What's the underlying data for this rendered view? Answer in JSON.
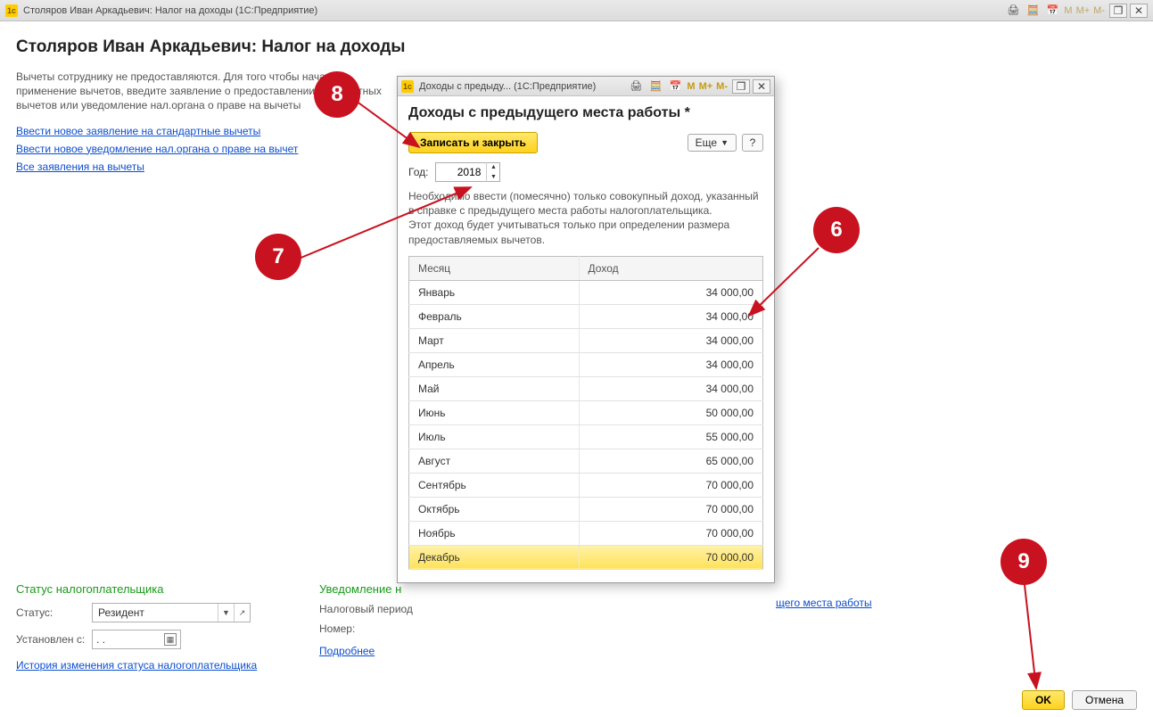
{
  "main_window": {
    "title": "Столяров Иван Аркадьевич: Налог на доходы  (1С:Предприятие)",
    "page_heading": "Столяров Иван Аркадьевич: Налог на доходы",
    "description": "Вычеты сотруднику не предоставляются. Для того чтобы начать применение вычетов, введите заявление о предоставлении стандартных вычетов или уведомление нал.органа о праве на вычеты",
    "links": {
      "std_deduction": "Ввести новое заявление на стандартные вычеты",
      "notice": "Ввести новое уведомление нал.органа о праве на вычет",
      "all_statements": "Все заявления на вычеты"
    },
    "status_section_title": "Статус налогоплательщика",
    "status_label": "Статус:",
    "status_value": "Резидент",
    "set_from_label": "Установлен с:",
    "set_from_value": "  .  .    ",
    "history_link": "История изменения статуса налогоплательщика",
    "notice_section_title": "Уведомление н",
    "tax_period_label": "Налоговый период",
    "number_label": "Номер:",
    "more_link": "Подробнее",
    "prev_place_link": "щего места работы",
    "ok_label": "OK",
    "cancel_label": "Отмена",
    "titlebar_tokens": {
      "m": "M",
      "mplus": "M+",
      "mminus": "M-"
    }
  },
  "modal": {
    "title_short": "Доходы с предыду...  (1С:Предприятие)",
    "heading": "Доходы с предыдущего места работы *",
    "save_close": "Записать и закрыть",
    "more": "Еще",
    "help": "?",
    "year_label": "Год:",
    "year_value": "2018",
    "description": "Необходимо ввести (помесячно) только совокупный доход, указанный в справке с предыдущего места работы налогоплательщика.\nЭтот доход будет учитываться только при определении размера предоставляемых вычетов.",
    "col_month": "Месяц",
    "col_income": "Доход",
    "rows": [
      {
        "month": "Январь",
        "amount": "34 000,00"
      },
      {
        "month": "Февраль",
        "amount": "34 000,00"
      },
      {
        "month": "Март",
        "amount": "34 000,00"
      },
      {
        "month": "Апрель",
        "amount": "34 000,00"
      },
      {
        "month": "Май",
        "amount": "34 000,00"
      },
      {
        "month": "Июнь",
        "amount": "50 000,00"
      },
      {
        "month": "Июль",
        "amount": "55 000,00"
      },
      {
        "month": "Август",
        "amount": "65 000,00"
      },
      {
        "month": "Сентябрь",
        "amount": "70 000,00"
      },
      {
        "month": "Октябрь",
        "amount": "70 000,00"
      },
      {
        "month": "Ноябрь",
        "amount": "70 000,00"
      },
      {
        "month": "Декабрь",
        "amount": "70 000,00"
      }
    ],
    "titlebar_tokens": {
      "m": "M",
      "mplus": "M+",
      "mminus": "M-"
    }
  },
  "annotations": {
    "n6": "6",
    "n7": "7",
    "n8": "8",
    "n9": "9"
  }
}
